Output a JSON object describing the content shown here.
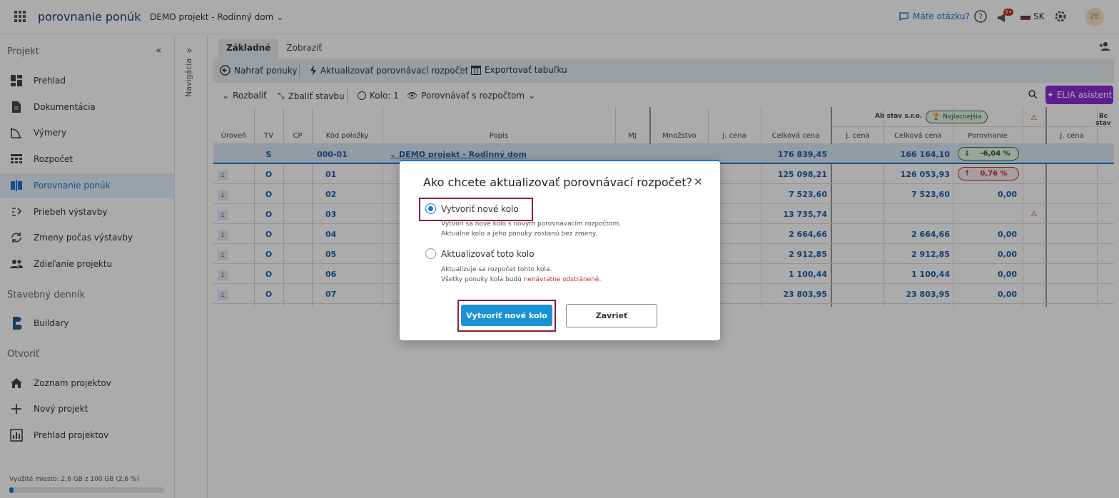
{
  "topbar": {
    "app_name": "porovnanie ponúk",
    "project_name": "DEMO projekt - Rodinný dom",
    "question_link": "Máte otázku?",
    "notification_badge": "9+",
    "language": "SK",
    "avatar_initials": "ZE"
  },
  "sidebar": {
    "section_project": "Projekt",
    "items_project": [
      {
        "label": "Prehlad",
        "icon": "dashboard-icon"
      },
      {
        "label": "Dokumentácia",
        "icon": "document-icon"
      },
      {
        "label": "Výmery",
        "icon": "measure-icon"
      },
      {
        "label": "Rozpočet",
        "icon": "budget-icon"
      },
      {
        "label": "Porovnanie ponúk",
        "icon": "compare-icon"
      },
      {
        "label": "Priebeh výstavby",
        "icon": "progress-icon"
      },
      {
        "label": "Zmeny počas výstavby",
        "icon": "changes-icon"
      },
      {
        "label": "Zdieľanie projektu",
        "icon": "share-icon"
      }
    ],
    "section_diary": "Stavebný denník",
    "items_diary": [
      {
        "label": "Buildary",
        "icon": "buildary-icon"
      }
    ],
    "section_open": "Otvoriť",
    "items_open": [
      {
        "label": "Zoznam projektov",
        "icon": "home-icon"
      },
      {
        "label": "Nový projekt",
        "icon": "plus-icon"
      },
      {
        "label": "Prehlad projektov",
        "icon": "chart-icon"
      }
    ],
    "storage_text": "Využité miesto: 2,6 GB z 100 GB (2,6 %)",
    "storage_percent": 2.6
  },
  "navigation_label": "Navigácia",
  "tabs": [
    "Základné",
    "Zobraziť"
  ],
  "toolbar": {
    "upload": "Nahrať ponuky",
    "update_budget": "Aktualizovať porovnávací rozpočet",
    "export": "Exportovať tabuľku"
  },
  "subbar": {
    "expand": "Rozbaliť",
    "collapse": "Zbaliť stavbu",
    "round": "Kolo: 1",
    "compare": "Porovnávať s rozpočtom",
    "elia": "ELIA asistent"
  },
  "grid": {
    "headers": [
      "Úroveň",
      "TV",
      "CP",
      "Kód položky",
      "Popis",
      "MJ",
      "Množstvo",
      "J. cena",
      "Celková cena",
      "J. cena",
      "Celková cena",
      "Porovnanie",
      "J. cena"
    ],
    "supplier_a": "Ab stav s.r.o.",
    "supplier_a_badge": "Najlacnejšia",
    "supplier_b": "Bc stav",
    "top_row": {
      "tv": "S",
      "code": "000-01",
      "desc": "DEMO projekt - Rodinný dom",
      "total": "176 839,45",
      "a_total": "166 164,10",
      "a_cmp": "-6,04 %"
    },
    "rows": [
      {
        "lvl": "1",
        "tv": "O",
        "code": "01",
        "total": "125 098,21",
        "a_total": "126 053,93",
        "a_cmp": "0,76 %"
      },
      {
        "lvl": "1",
        "tv": "O",
        "code": "02",
        "total": "7 523,60",
        "a_total": "7 523,60",
        "a_cmp": "0,00"
      },
      {
        "lvl": "1",
        "tv": "O",
        "code": "03",
        "total": "13 735,74",
        "a_total": "",
        "a_cmp": ""
      },
      {
        "lvl": "1",
        "tv": "O",
        "code": "04",
        "total": "2 664,66",
        "a_total": "2 664,66",
        "a_cmp": "0,00"
      },
      {
        "lvl": "1",
        "tv": "O",
        "code": "05",
        "total": "2 912,85",
        "a_total": "2 912,85",
        "a_cmp": "0,00"
      },
      {
        "lvl": "1",
        "tv": "O",
        "code": "06",
        "total": "1 100,44",
        "a_total": "1 100,44",
        "a_cmp": "0,00"
      },
      {
        "lvl": "1",
        "tv": "O",
        "code": "07",
        "total": "23 803,95",
        "a_total": "23 803,95",
        "a_cmp": "0,00"
      }
    ]
  },
  "dialog": {
    "title": "Ako chcete aktualizovať porovnávací rozpočet?",
    "option_new": "Vytvoriť nové kolo",
    "option_new_desc1": "Vytvorí sa nové kolo s novým porovnávacím rozpočtom.",
    "option_new_desc2": "Aktuálne kolo a jeho ponuky zostanú bez zmeny.",
    "option_update": "Aktualizovať toto kolo",
    "option_update_desc1": "Aktualizuje sa rozpočet tohto kola.",
    "option_update_desc2_pre": "Všetky ponuky kola budú ",
    "option_update_desc2_red": "nenávratne odstránené",
    "option_update_desc2_post": ".",
    "confirm": "Vytvoriť nové kolo",
    "cancel": "Zavrieť"
  },
  "colors": {
    "accent": "#1976d2",
    "highlight": "#8e1e3e",
    "elia": "#8b2fd6"
  }
}
